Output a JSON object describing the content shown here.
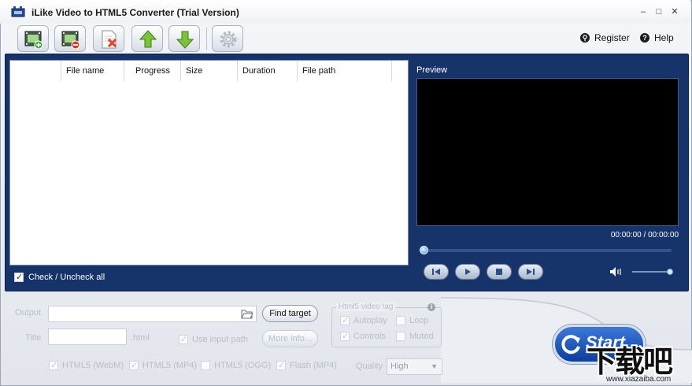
{
  "window": {
    "title": "iLike Video to HTML5 Converter (Trial Version)"
  },
  "toolbar": {
    "buttons": [
      {
        "name": "add-video-icon"
      },
      {
        "name": "remove-video-icon"
      },
      {
        "name": "clear-list-icon"
      },
      {
        "name": "move-up-icon"
      },
      {
        "name": "move-down-icon"
      },
      {
        "name": "settings-icon"
      }
    ]
  },
  "links": {
    "register": "Register",
    "help": "Help"
  },
  "file_list": {
    "columns": [
      "",
      "File name",
      "Progress",
      "Size",
      "Duration",
      "File path"
    ],
    "rows": []
  },
  "check_all": "Check / Uncheck all",
  "preview": {
    "label": "Preview",
    "timecode": "00:00:00 / 00:00:00"
  },
  "output": {
    "output_label": "Output",
    "output_value": "",
    "find_target": "Find target",
    "title_label": "Title",
    "title_value": "",
    "html_ext": ".html",
    "use_input_path": "Use input path",
    "more_info": "More info...",
    "html5_tag_title": "Html5 video tag",
    "autoplay": "Autoplay",
    "loop": "Loop",
    "controls": "Controls",
    "muted": "Muted",
    "formats": {
      "webm": "HTML5 (WebM)",
      "mp4": "HTML5 (MP4)",
      "ogg": "HTML5 (OGG)",
      "flash": "Flash (MP4)"
    },
    "quality_label": "Quality",
    "quality_value": "High"
  },
  "start": {
    "label": "Start"
  },
  "watermark": {
    "logo": "下载吧",
    "url": "www.xiazaiba.com"
  }
}
